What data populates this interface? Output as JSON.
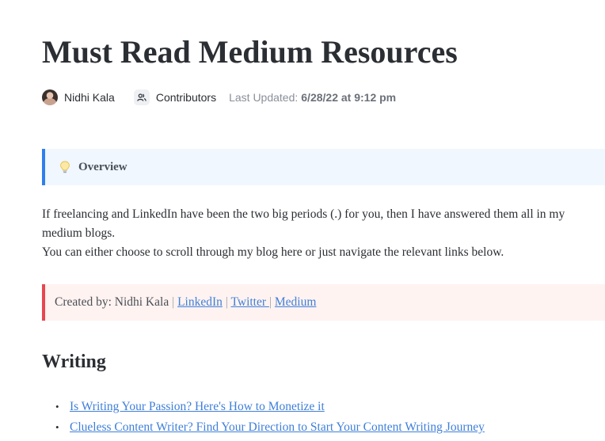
{
  "doc": {
    "title": "Must Read Medium Resources",
    "author": "Nidhi Kala",
    "contributors_label": "Contributors",
    "last_updated_label": "Last Updated:",
    "last_updated_value": "6/28/22 at 9:12 pm"
  },
  "overview": {
    "icon": "lightbulb-icon",
    "label": "Overview",
    "accent": "#2f80ed",
    "background": "#f0f7ff"
  },
  "intro": {
    "line1": "If freelancing and LinkedIn have been the two big periods (.) for you, then I have answered them all in my medium blogs.",
    "line2": "You can either choose to scroll through my blog here or just navigate the relevant links below."
  },
  "created_by": {
    "prefix": "Created by: Nidhi Kala",
    "separator": "|",
    "links": [
      "LinkedIn",
      "Twitter ",
      "Medium"
    ],
    "accent": "#e5484d",
    "background": "#fff3f1"
  },
  "writing": {
    "heading": "Writing",
    "articles": [
      "Is Writing Your Passion? Here's How to Monetize it",
      "Clueless Content Writer? Find Your Direction to Start Your Content Writing Journey"
    ]
  },
  "colors": {
    "link": "#3f7fd8",
    "text": "#2b2e33",
    "muted": "#8a8f98"
  }
}
